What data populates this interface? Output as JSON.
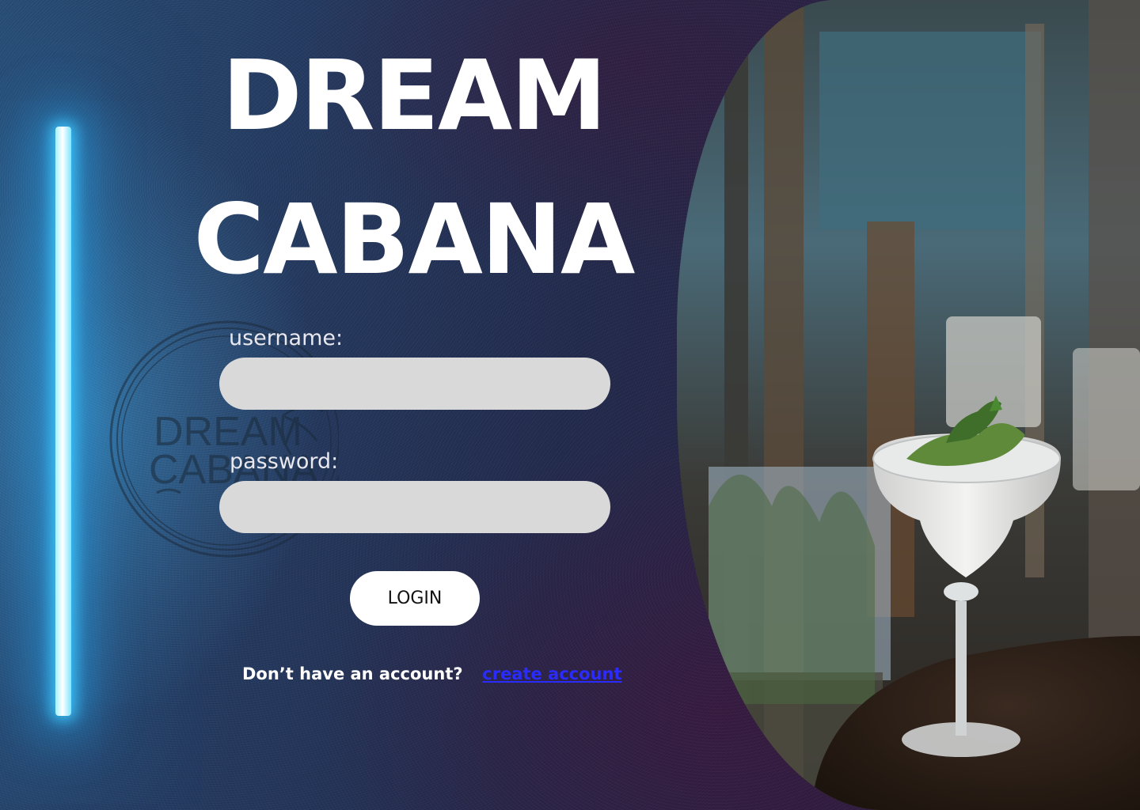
{
  "brand": {
    "title_line1": "DREAM",
    "title_line2": "CABANA",
    "logo_text_line1": "DREAM",
    "logo_text_line2": "CABANA"
  },
  "login_form": {
    "username_label": "username:",
    "username_value": "",
    "password_label": "password:",
    "password_value": "",
    "login_button": "LOGIN"
  },
  "signup": {
    "prompt": "Don’t have an account?",
    "link_text": "create account"
  },
  "colors": {
    "title": "#ffffff",
    "field_bg": "#d9d9d9",
    "button_bg": "#ffffff",
    "link": "#2a2cff",
    "neon": "#5fd8ff"
  },
  "icons": {
    "neon_light": "neon-light-bar",
    "logo": "dream-cabana-logo-stamp",
    "hero_photo": "cocktail-photo"
  }
}
